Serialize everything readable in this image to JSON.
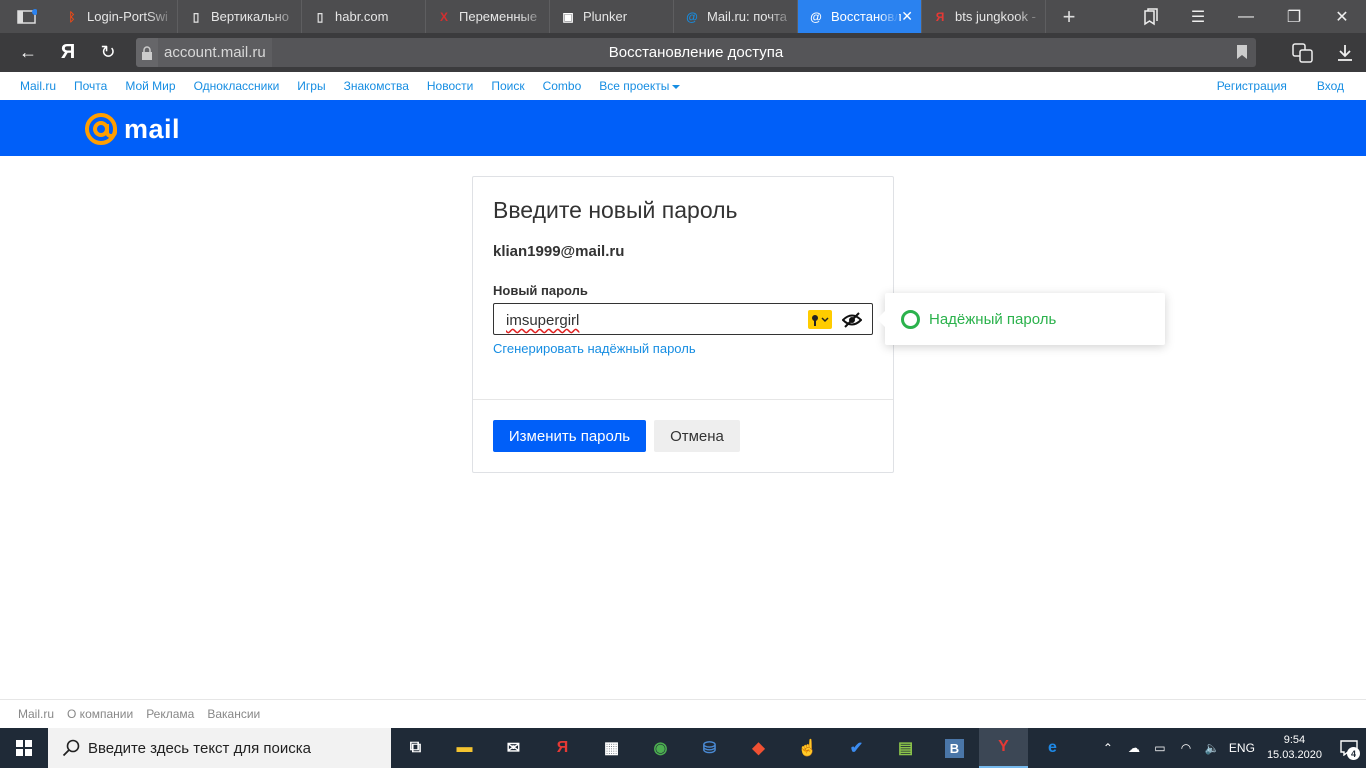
{
  "browser": {
    "tabs": [
      {
        "label": "Login-PortSwi",
        "fav_color": "#e64a19",
        "fav_glyph": "ᛒ"
      },
      {
        "label": "Вертикально",
        "fav_color": "#e0e0e0",
        "fav_glyph": "▯"
      },
      {
        "label": "habr.com",
        "fav_color": "#e0e0e0",
        "fav_glyph": "▯"
      },
      {
        "label": "Переменные",
        "fav_color": "#d32f2f",
        "fav_glyph": "Х"
      },
      {
        "label": "Plunker",
        "fav_color": "#ffffff",
        "fav_glyph": "▣"
      },
      {
        "label": "Mail.ru: почта",
        "fav_color": "#168de2",
        "fav_glyph": "@"
      },
      {
        "label": "Восстановле",
        "fav_color": "#ffffff",
        "fav_glyph": "@"
      },
      {
        "label": "bts jungkook -",
        "fav_color": "#e53935",
        "fav_glyph": "Я"
      }
    ],
    "active_tab_index": 6,
    "url_host": "account.mail.ru",
    "page_title": "Восстановление доступа",
    "accent": "#2a82f0"
  },
  "portal_menu": {
    "items": [
      "Mail.ru",
      "Почта",
      "Мой Мир",
      "Одноклассники",
      "Игры",
      "Знакомства",
      "Новости",
      "Поиск",
      "Combo",
      "Все проекты"
    ],
    "register": "Регистрация",
    "login": "Вход"
  },
  "header": {
    "logo_text": "mail",
    "brand_color": "#005ff9",
    "logo_at_color": "#ff9e00"
  },
  "form": {
    "title": "Введите новый пароль",
    "email": "klian1999@mail.ru",
    "password_label": "Новый пароль",
    "password_value": "imsupergirl",
    "generate_link": "Сгенерировать надёжный пароль",
    "submit_label": "Изменить пароль",
    "cancel_label": "Отмена"
  },
  "strength": {
    "text": "Надёжный пароль",
    "color": "#2bb24c"
  },
  "footer": {
    "links": [
      "Mail.ru",
      "О компании",
      "Реклама",
      "Вакансии"
    ]
  },
  "taskbar": {
    "search_placeholder": "Введите здесь текст для поиска",
    "apps": [
      "task-view-icon",
      "file-explorer-icon",
      "mail-icon",
      "yandex-app-icon",
      "store-icon",
      "chrome-icon",
      "python-icon",
      "git-icon",
      "hand-tool-icon",
      "todo-icon",
      "chart-app-icon",
      "vk-icon",
      "yandex-browser-icon",
      "edge-icon"
    ],
    "language": "ENG",
    "time": "9:54",
    "date": "15.03.2020",
    "notification_count": "4"
  }
}
